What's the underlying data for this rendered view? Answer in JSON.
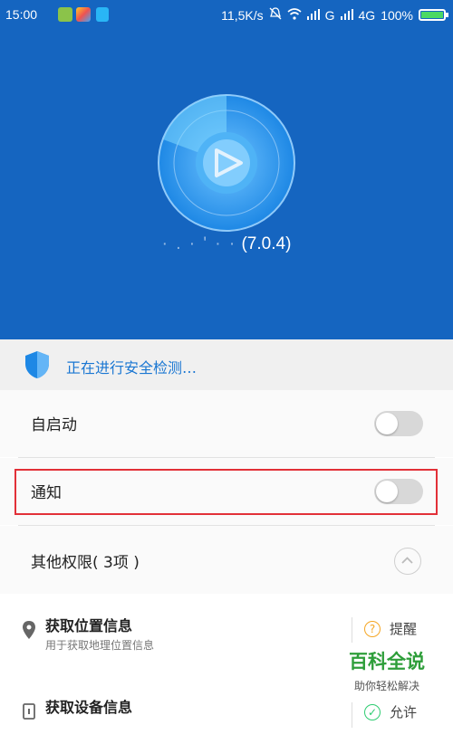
{
  "status_bar": {
    "time": "15:00",
    "speed": "11,5K/s",
    "signal1_label": "G",
    "signal2_label": "4G",
    "battery": "100%",
    "battery_level": 1.0
  },
  "hero": {
    "version": "(7.0.4)",
    "version_obscured": "·  .  ·  ' ·  ·"
  },
  "scan": {
    "status_text": "正在进行安全检测…"
  },
  "settings": {
    "autostart_label": "自启动",
    "autostart_on": false,
    "notify_label": "通知",
    "notify_on": false,
    "other_perms_label": "其他权限( 3项 )"
  },
  "permissions": [
    {
      "title": "获取位置信息",
      "subtitle": "用于获取地理位置信息",
      "action": "提醒",
      "action_icon": "question-icon"
    },
    {
      "title": "获取设备信息",
      "subtitle": "",
      "action": "允许",
      "action_icon": "check-icon"
    }
  ],
  "watermark": {
    "title": "百科全说",
    "subtitle": "助你轻松解决"
  },
  "colors": {
    "primary": "#1565c0",
    "scan_text": "#1976d2",
    "highlight": "#e23038",
    "remind": "#f5a623",
    "allow": "#2ecc71"
  }
}
